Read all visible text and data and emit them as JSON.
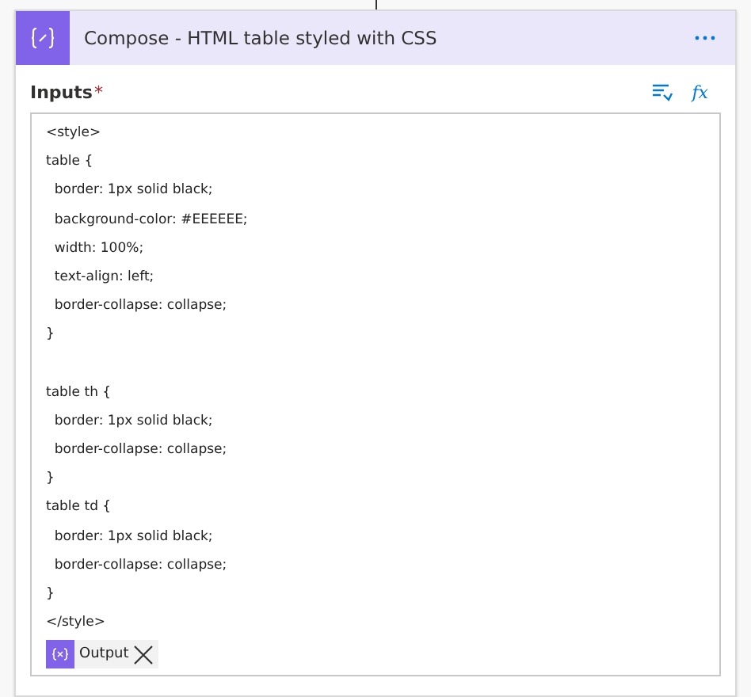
{
  "card": {
    "title": "Compose - HTML table styled with CSS"
  },
  "inputs": {
    "label": "Inputs",
    "required_mark": "*",
    "expression_button": "fx",
    "lines": [
      {
        "kind": "code",
        "text": "<style>"
      },
      {
        "kind": "code",
        "text": "table {"
      },
      {
        "kind": "code",
        "text": "  border: 1px solid black;"
      },
      {
        "kind": "code",
        "text": "  background-color: #EEEEEE;"
      },
      {
        "kind": "code",
        "text": "  width: 100%;"
      },
      {
        "kind": "code",
        "text": "  text-align: left;"
      },
      {
        "kind": "code",
        "text": "  border-collapse: collapse;"
      },
      {
        "kind": "code",
        "text": "}"
      },
      {
        "kind": "blank"
      },
      {
        "kind": "code",
        "text": "table th {"
      },
      {
        "kind": "code",
        "text": "  border: 1px solid black;"
      },
      {
        "kind": "code",
        "text": "  border-collapse: collapse;"
      },
      {
        "kind": "code",
        "text": "}"
      },
      {
        "kind": "code",
        "text": "table td {"
      },
      {
        "kind": "code",
        "text": "  border: 1px solid black;"
      },
      {
        "kind": "code",
        "text": "  border-collapse: collapse;"
      },
      {
        "kind": "code",
        "text": "}"
      },
      {
        "kind": "code",
        "text": "</style>"
      }
    ],
    "token": {
      "label": "Output"
    }
  }
}
